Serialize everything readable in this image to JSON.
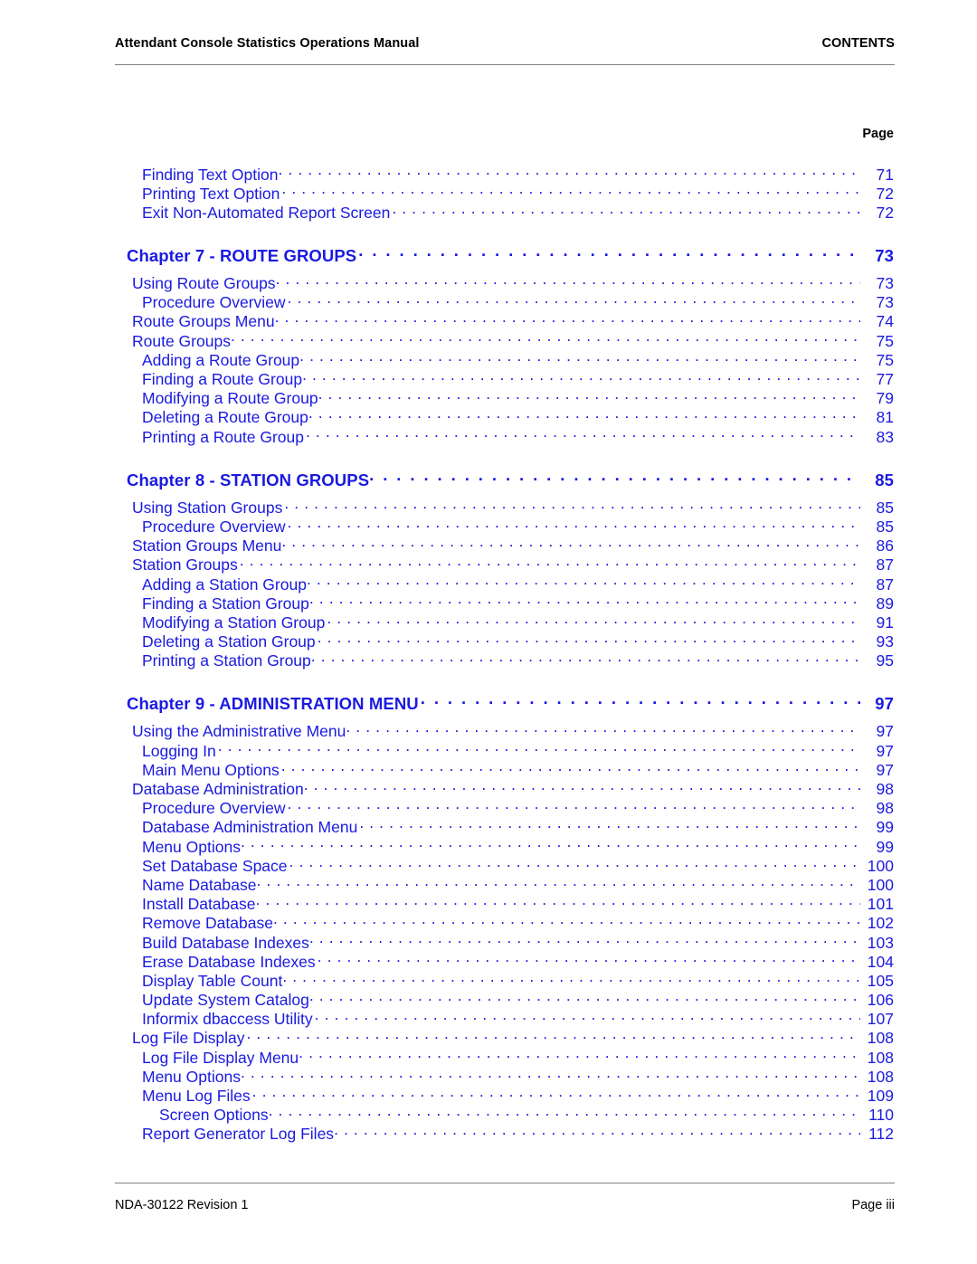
{
  "header": {
    "document_title": "Attendant Console Statistics Operations Manual",
    "section_label": "CONTENTS"
  },
  "column_header": {
    "page_label": "Page"
  },
  "colors": {
    "entry_blue": "#1a1ae0",
    "text_black": "#000000",
    "rule_gray": "#808080"
  },
  "toc": {
    "entries": [
      {
        "title": "Finding Text Option",
        "page": "71",
        "level": 2,
        "tight": true
      },
      {
        "title": "Printing Text Option",
        "page": "72",
        "level": 2,
        "tight": false
      },
      {
        "title": "Exit Non-Automated Report Screen",
        "page": "72",
        "level": 2,
        "tight": false
      },
      {
        "title": "Chapter 7 - ROUTE GROUPS",
        "page": "73",
        "level": 0,
        "tight": false,
        "chapter": true,
        "gap_before": true,
        "gap_after": true
      },
      {
        "title": "Using Route Groups",
        "page": "73",
        "level": 1,
        "tight": true
      },
      {
        "title": "Procedure Overview",
        "page": "73",
        "level": 2,
        "tight": false
      },
      {
        "title": "Route Groups Menu",
        "page": "74",
        "level": 1,
        "tight": true
      },
      {
        "title": "Route Groups",
        "page": "75",
        "level": 1,
        "tight": true
      },
      {
        "title": "Adding a Route Group",
        "page": "75",
        "level": 2,
        "tight": true
      },
      {
        "title": "Finding a Route Group",
        "page": "77",
        "level": 2,
        "tight": true
      },
      {
        "title": "Modifying a Route Group",
        "page": "79",
        "level": 2,
        "tight": true
      },
      {
        "title": "Deleting a Route Group",
        "page": "81",
        "level": 2,
        "tight": true
      },
      {
        "title": "Printing a Route Group",
        "page": "83",
        "level": 2,
        "tight": false
      },
      {
        "title": "Chapter 8 - STATION GROUPS",
        "page": "85",
        "level": 0,
        "tight": true,
        "chapter": true,
        "gap_before": true,
        "gap_after": true
      },
      {
        "title": "Using Station Groups",
        "page": "85",
        "level": 1,
        "tight": false
      },
      {
        "title": "Procedure Overview",
        "page": "85",
        "level": 2,
        "tight": false
      },
      {
        "title": "Station Groups Menu",
        "page": "86",
        "level": 1,
        "tight": true
      },
      {
        "title": "Station Groups",
        "page": "87",
        "level": 1,
        "tight": false
      },
      {
        "title": "Adding a Station Group",
        "page": "87",
        "level": 2,
        "tight": true
      },
      {
        "title": "Finding a Station Group",
        "page": "89",
        "level": 2,
        "tight": true
      },
      {
        "title": "Modifying a Station Group",
        "page": "91",
        "level": 2,
        "tight": false
      },
      {
        "title": "Deleting a Station Group",
        "page": "93",
        "level": 2,
        "tight": false
      },
      {
        "title": "Printing a Station Group",
        "page": "95",
        "level": 2,
        "tight": true
      },
      {
        "title": "Chapter 9 - ADMINISTRATION MENU",
        "page": "97",
        "level": 0,
        "tight": false,
        "chapter": true,
        "gap_before": true,
        "gap_after": true
      },
      {
        "title": "Using the Administrative Menu",
        "page": "97",
        "level": 1,
        "tight": true
      },
      {
        "title": "Logging In",
        "page": "97",
        "level": 2,
        "tight": false
      },
      {
        "title": "Main Menu Options",
        "page": "97",
        "level": 2,
        "tight": false
      },
      {
        "title": "Database Administration",
        "page": "98",
        "level": 1,
        "tight": true
      },
      {
        "title": "Procedure Overview",
        "page": "98",
        "level": 2,
        "tight": false
      },
      {
        "title": "Database Administration Menu",
        "page": "99",
        "level": 2,
        "tight": false
      },
      {
        "title": "Menu Options",
        "page": "99",
        "level": 2,
        "tight": true
      },
      {
        "title": "Set Database Space",
        "page": "100",
        "level": 2,
        "tight": false
      },
      {
        "title": "Name Database",
        "page": "100",
        "level": 2,
        "tight": true
      },
      {
        "title": "Install Database",
        "page": "101",
        "level": 2,
        "tight": true
      },
      {
        "title": "Remove Database",
        "page": "102",
        "level": 2,
        "tight": true
      },
      {
        "title": "Build Database Indexes",
        "page": "103",
        "level": 2,
        "tight": true
      },
      {
        "title": "Erase Database Indexes",
        "page": "104",
        "level": 2,
        "tight": false
      },
      {
        "title": "Display Table Count",
        "page": "105",
        "level": 2,
        "tight": true
      },
      {
        "title": "Update System Catalog",
        "page": "106",
        "level": 2,
        "tight": true
      },
      {
        "title": "Informix dbaccess Utility",
        "page": "107",
        "level": 2,
        "tight": false
      },
      {
        "title": "Log File Display",
        "page": "108",
        "level": 1,
        "tight": false
      },
      {
        "title": "Log File Display Menu",
        "page": "108",
        "level": 2,
        "tight": true
      },
      {
        "title": "Menu Options",
        "page": "108",
        "level": 2,
        "tight": true
      },
      {
        "title": "Menu Log Files",
        "page": "109",
        "level": 2,
        "tight": false
      },
      {
        "title": "Screen Options",
        "page": "110",
        "level": 3,
        "tight": true
      },
      {
        "title": "Report Generator Log Files",
        "page": "112",
        "level": 2,
        "tight": true
      }
    ]
  },
  "footer": {
    "document_number": "NDA-30122  Revision 1",
    "page_number": "Page iii"
  }
}
